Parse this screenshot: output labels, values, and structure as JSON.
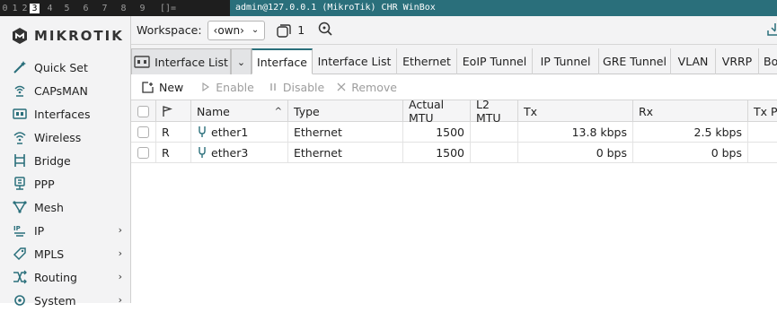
{
  "topbar": {
    "workspaces": [
      "0",
      "1",
      "2",
      "3",
      "4",
      "5",
      "6",
      "7",
      "8",
      "9"
    ],
    "active_workspace": "3",
    "layout_symbol": "[]=",
    "window_title": "admin@127.0.0.1 (MikroTik) CHR WinBox"
  },
  "brand": {
    "logo_text": "MikroTik"
  },
  "sidebar": {
    "items": [
      {
        "label": "Quick Set",
        "icon": "wand-icon",
        "has_submenu": false
      },
      {
        "label": "CAPsMAN",
        "icon": "wireless-ap-icon",
        "has_submenu": false
      },
      {
        "label": "Interfaces",
        "icon": "interfaces-icon",
        "has_submenu": false
      },
      {
        "label": "Wireless",
        "icon": "wireless-icon",
        "has_submenu": false
      },
      {
        "label": "Bridge",
        "icon": "bridge-icon",
        "has_submenu": false
      },
      {
        "label": "PPP",
        "icon": "ppp-icon",
        "has_submenu": false
      },
      {
        "label": "Mesh",
        "icon": "mesh-icon",
        "has_submenu": false
      },
      {
        "label": "IP",
        "icon": "ip-icon",
        "has_submenu": true
      },
      {
        "label": "MPLS",
        "icon": "mpls-icon",
        "has_submenu": true
      },
      {
        "label": "Routing",
        "icon": "routing-icon",
        "has_submenu": true
      },
      {
        "label": "System",
        "icon": "system-gear-icon",
        "has_submenu": true
      }
    ]
  },
  "workspace_bar": {
    "label": "Workspace:",
    "selected": "‹own›",
    "window_count": "1"
  },
  "tabs": {
    "menu_tab": "Interface List",
    "items": [
      "Interface",
      "Interface List",
      "Ethernet",
      "EoIP Tunnel",
      "IP Tunnel",
      "GRE Tunnel",
      "VLAN",
      "VRRP",
      "Bo"
    ],
    "active": "Interface"
  },
  "toolbar": {
    "new_label": "New",
    "enable_label": "Enable",
    "disable_label": "Disable",
    "remove_label": "Remove"
  },
  "table": {
    "columns": [
      "",
      "",
      "Name",
      "Type",
      "Actual MTU",
      "L2 MTU",
      "Tx",
      "Rx",
      "Tx Pa"
    ],
    "sort_indicator": "^",
    "rows": [
      {
        "flag": "R",
        "name": "ether1",
        "type": "Ethernet",
        "actual_mtu": "1500",
        "l2_mtu": "",
        "tx": "13.8 kbps",
        "rx": "2.5 kbps",
        "tx_packets": ""
      },
      {
        "flag": "R",
        "name": "ether3",
        "type": "Ethernet",
        "actual_mtu": "1500",
        "l2_mtu": "",
        "tx": "0 bps",
        "rx": "0 bps",
        "tx_packets": ""
      }
    ]
  },
  "colors": {
    "accent": "#2a6f7b",
    "sidebar_bg": "#f3f3f4",
    "topbar_bg": "#1e1e1e"
  }
}
